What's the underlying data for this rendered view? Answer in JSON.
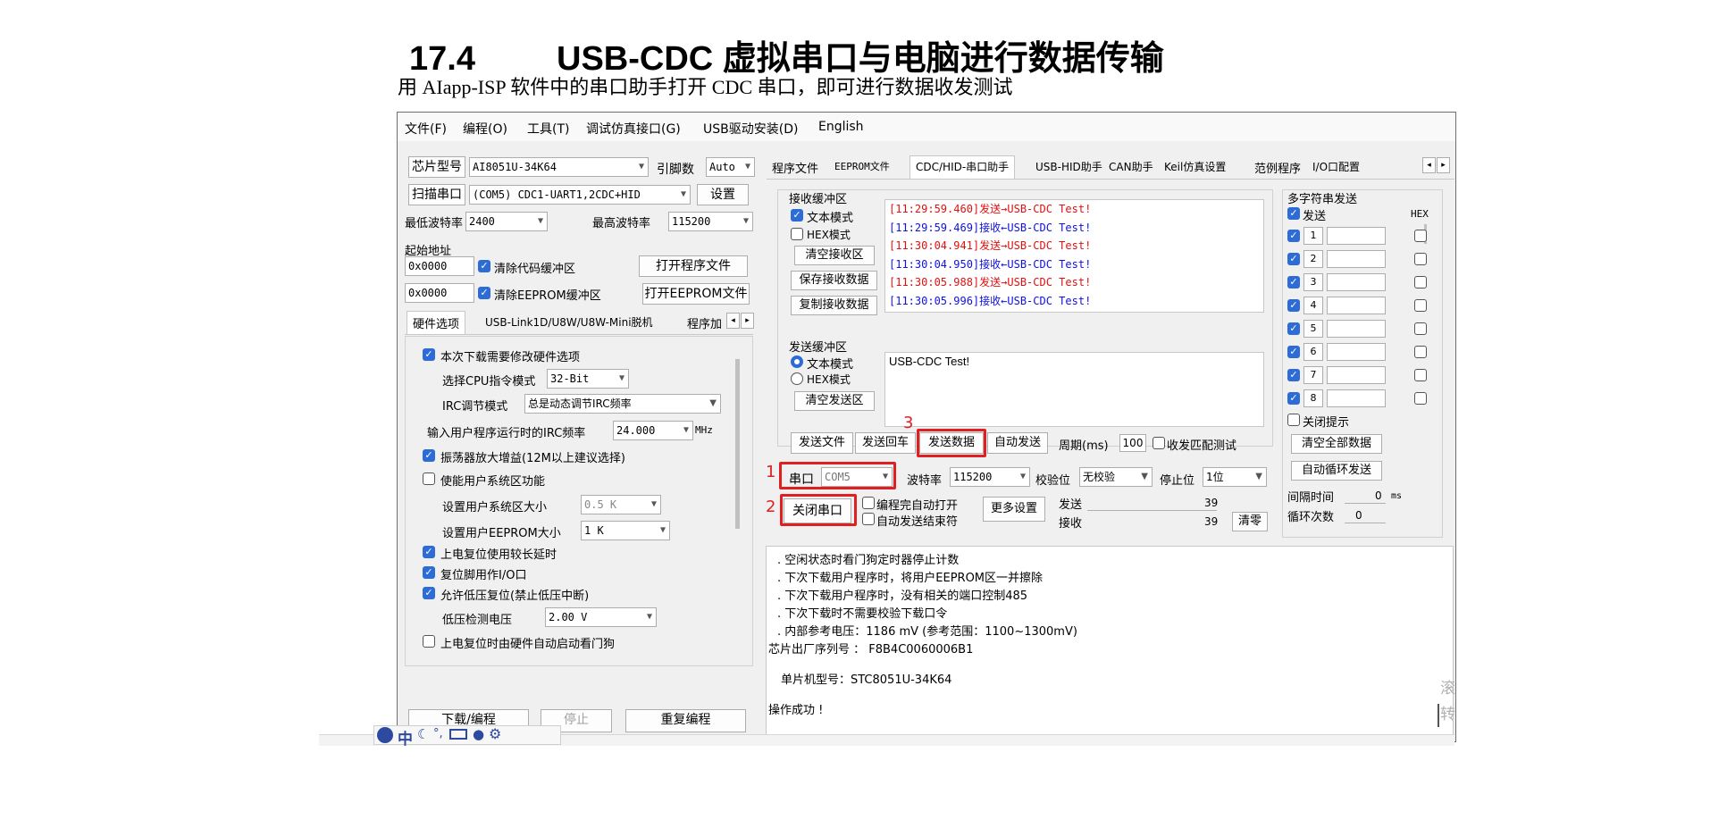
{
  "doc": {
    "heading_number": "17.4",
    "heading_text": "USB-CDC 虚拟串口与电脑进行数据传输",
    "subtitle": "用 AIapp-ISP 软件中的串口助手打开 CDC 串口，即可进行数据收发测试"
  },
  "menu": [
    "文件(F)",
    "编程(O)",
    "工具(T)",
    "调试仿真接口(G)",
    "USB驱动安装(D)",
    "English"
  ],
  "left": {
    "chip_btn": "芯片型号",
    "chip_value": "AI8051U-34K64",
    "pins_label": "引脚数",
    "pins_value": "Auto",
    "scan_btn": "扫描串口",
    "port_value": "(COM5) CDC1-UART1,2CDC+HID",
    "settings_btn": "设置",
    "min_baud_label": "最低波特率",
    "min_baud": "2400",
    "max_baud_label": "最高波特率",
    "max_baud": "115200",
    "start_addr_label": "起始地址",
    "addr1": "0x0000",
    "clear_code": "清除代码缓冲区",
    "open_prog": "打开程序文件",
    "addr2": "0x0000",
    "clear_eeprom": "清除EEPROM缓冲区",
    "open_eeprom": "打开EEPROM文件",
    "tabs": [
      "硬件选项",
      "USB-Link1D/U8W/U8W-Mini脱机",
      "程序加"
    ],
    "opt_modify_hw": "本次下载需要修改硬件选项",
    "cpu_mode_label": "选择CPU指令模式",
    "cpu_mode": "32-Bit",
    "irc_label": "IRC调节模式",
    "irc_value": "总是动态调节IRC频率",
    "freq_label": "输入用户程序运行时的IRC频率",
    "freq_value": "24.000",
    "freq_unit": "MHz",
    "opt_osc": "振荡器放大增益(12M以上建议选择)",
    "opt_user_sys": "使能用户系统区功能",
    "user_sys_size_label": "设置用户系统区大小",
    "user_sys_size": "0.5 K",
    "eeprom_size_label": "设置用户EEPROM大小",
    "eeprom_size": "1   K",
    "opt_long_delay": "上电复位使用较长延时",
    "opt_reset_io": "复位脚用作I/O口",
    "opt_lvr": "允许低压复位(禁止低压中断)",
    "lvd_label": "低压检测电压",
    "lvd_value": "2.00 V",
    "opt_wdt": "上电复位时由硬件自动启动看门狗",
    "download_btn": "下载/编程",
    "stop_btn": "停止",
    "repeat_btn": "重复编程"
  },
  "right": {
    "tabs": [
      "程序文件",
      "EEPROM文件",
      "CDC/HID-串口助手",
      "USB-HID助手",
      "CAN助手",
      "Keil仿真设置",
      "范例程序",
      "I/O口配置"
    ],
    "recv_group": "接收缓冲区",
    "recv_text_mode": "文本模式",
    "recv_hex_mode": "HEX模式",
    "clear_recv": "清空接收区",
    "save_recv": "保存接收数据",
    "copy_recv": "复制接收数据",
    "recv_lines": [
      {
        "t": "[11:29:59.460]发送→USB-CDC Test!",
        "c": "red"
      },
      {
        "t": "[11:29:59.469]接收←USB-CDC Test!",
        "c": "blue"
      },
      {
        "t": "[11:30:04.941]发送→USB-CDC Test!",
        "c": "red"
      },
      {
        "t": "[11:30:04.950]接收←USB-CDC Test!",
        "c": "blue"
      },
      {
        "t": "[11:30:05.988]发送→USB-CDC Test!",
        "c": "red"
      },
      {
        "t": "[11:30:05.996]接收←USB-CDC Test!",
        "c": "blue"
      }
    ],
    "send_group": "发送缓冲区",
    "send_text_mode": "文本模式",
    "send_hex_mode": "HEX模式",
    "clear_send": "清空发送区",
    "send_content": "USB-CDC Test!",
    "send_file": "发送文件",
    "send_enter": "发送回车",
    "send_data": "发送数据",
    "auto_send": "自动发送",
    "period_label": "周期(ms)",
    "period_value": "100",
    "match_test": "收发匹配测试",
    "port_label": "串口",
    "port_value": "COM5",
    "baud_label": "波特率",
    "baud_value": "115200",
    "parity_label": "校验位",
    "parity_value": "无校验",
    "stop_label": "停止位",
    "stop_value": "1位",
    "close_port": "关闭串口",
    "auto_open": "编程完自动打开",
    "auto_end": "自动发送结束符",
    "more_settings": "更多设置",
    "send_count_label": "发送",
    "send_count": "39",
    "recv_count_label": "接收",
    "recv_count": "39",
    "clear_count": "清零",
    "multi_group": "多字符串发送",
    "multi_send": "发送",
    "multi_hex": "HEX",
    "multi_rows": [
      "1",
      "2",
      "3",
      "4",
      "5",
      "6",
      "7",
      "8"
    ],
    "close_tip": "关闭提示",
    "clear_all": "清空全部数据",
    "auto_loop": "自动循环发送",
    "interval_label": "间隔时间",
    "interval_value": "0",
    "interval_unit": "ms",
    "loop_label": "循环次数",
    "loop_value": "0",
    "annot": [
      "1",
      "2",
      "3"
    ]
  },
  "log": {
    "lines": [
      ". 空闲状态时看门狗定时器停止计数",
      ". 下次下载用户程序时，将用户EEPROM区一并擦除",
      ". 下次下载用户程序时，没有相关的端口控制485",
      ". 下次下载时不需要校验下载口令",
      ". 内部参考电压：1186 mV (参考范围：1100~1300mV)",
      "芯片出厂序列号 ： F8B4C0060006B1",
      "单片机型号：STC8051U-34K64",
      "操作成功 !"
    ]
  },
  "taskbar": {
    "ime_label": "中",
    "side_chars": [
      "滚",
      "转"
    ]
  }
}
